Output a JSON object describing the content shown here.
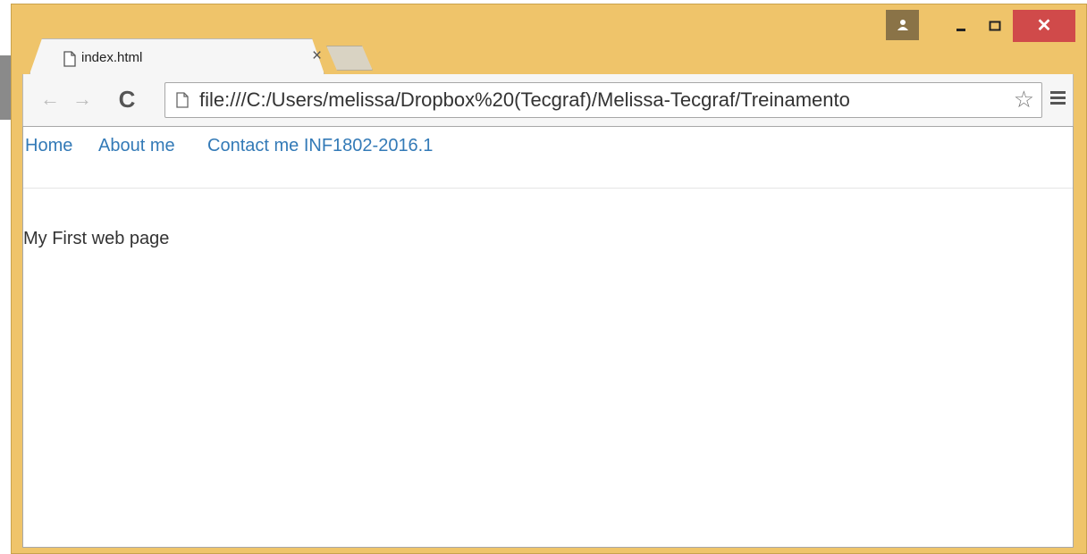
{
  "window": {
    "controls": {
      "user_icon": "user-icon",
      "minimize_icon": "minimize-icon",
      "maximize_icon": "maximize-icon",
      "close_label": "✕"
    },
    "colors": {
      "frame": "#efc46a",
      "close": "#d04a4a"
    }
  },
  "tabs": [
    {
      "title": "index.html",
      "close_label": "×",
      "icon": "page-icon"
    }
  ],
  "toolbar": {
    "back_label": "←",
    "forward_label": "→",
    "reload_label": "C",
    "url": "file:///C:/Users/melissa/Dropbox%20(Tecgraf)/Melissa-Tecgraf/Treinamento",
    "star_label": "☆",
    "menu_icon": "hamburger-menu-icon"
  },
  "page": {
    "nav": {
      "home": "Home",
      "about": "About me",
      "contact": "Contact me INF1802-2016.1"
    },
    "body_text": "My First web page",
    "link_color": "#337ab7"
  }
}
